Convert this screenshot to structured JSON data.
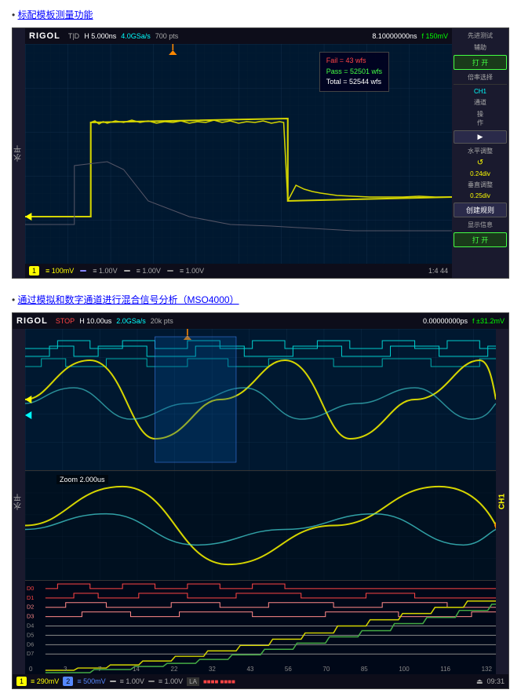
{
  "section1": {
    "title": "标配模板测量功能",
    "link": "标配模板测量功能"
  },
  "scope1": {
    "logo": "RIGOL",
    "status": "T|D",
    "timebase": "H 5.000ns",
    "sample_rate": "4.0GSa/s",
    "sample_pts": "700 pts",
    "trigger_time": "8.10000000ns",
    "trigger_icon": "T",
    "voltage": "f 150mV",
    "left_label": "水平",
    "info": {
      "fail": "Fail = 43 wfs",
      "pass": "Pass = 52501 wfs",
      "total": "Total = 52544 wfs"
    },
    "panel": {
      "advanced_test": "先进测试",
      "assist": "辅助",
      "open_btn": "打 开",
      "mask_select": "倍率选择",
      "channel": "CH1",
      "通道": "通道",
      "operation": "操作 作",
      "play_btn": "▶",
      "h_adjust": "水平调整",
      "h_value": "0.24div",
      "v_adjust": "垂直调整",
      "v_value": "0.25div",
      "create_rule": "创建规则",
      "show_info": "显示信息",
      "open_btn2": "打 开"
    },
    "channels": [
      {
        "id": "1",
        "color": "ch1",
        "value": "≡ 100mV"
      },
      {
        "id": "",
        "color": "ch2",
        "value": "≡ 1.00V"
      },
      {
        "id": "",
        "color": "ch3",
        "value": "≡ 1.00V"
      },
      {
        "id": "",
        "color": "ch4",
        "value": "≡ 1.00V"
      }
    ],
    "time": "1:4 44"
  },
  "section2": {
    "title": "通过模拟和数字通道进行混合信号分析（MSO4000）",
    "link": "通过模拟和数字通道进行混合信号分析（MSO4000）"
  },
  "scope2": {
    "logo": "RIGOL",
    "status": "STOP",
    "timebase": "H 10.00us",
    "sample_rate": "2.0GSa/s",
    "sample_pts": "20k pts",
    "trigger_time": "0.00000000ps",
    "voltage": "f ±31.2mV",
    "zoom_label": "Zoom 2.000us",
    "ch1_label": "CH1",
    "timescale": [
      "0",
      "3",
      "7",
      "14",
      "22",
      "32",
      "43",
      "56",
      "70",
      "85",
      "100",
      "116",
      "132"
    ],
    "digital_channels": [
      {
        "label": "D0",
        "color": "#f00"
      },
      {
        "label": "D1",
        "color": "#f00"
      },
      {
        "label": "D2",
        "color": "#f44"
      },
      {
        "label": "D3",
        "color": "#f44"
      },
      {
        "label": "D4",
        "color": "#888"
      },
      {
        "label": "D5",
        "color": "#888"
      },
      {
        "label": "D6",
        "color": "#888"
      },
      {
        "label": "D7",
        "color": "#888"
      }
    ],
    "channels": [
      {
        "id": "1",
        "color": "ch1",
        "value": "≡ 290mV"
      },
      {
        "id": "2",
        "color": "ch2",
        "value": "≡ 500mV"
      },
      {
        "id": "",
        "color": "ch3",
        "value": "≡ 1.00V"
      },
      {
        "id": "",
        "color": "ch4",
        "value": "≡ 1.00V"
      }
    ],
    "la_label": "LA",
    "time": "09:31"
  }
}
